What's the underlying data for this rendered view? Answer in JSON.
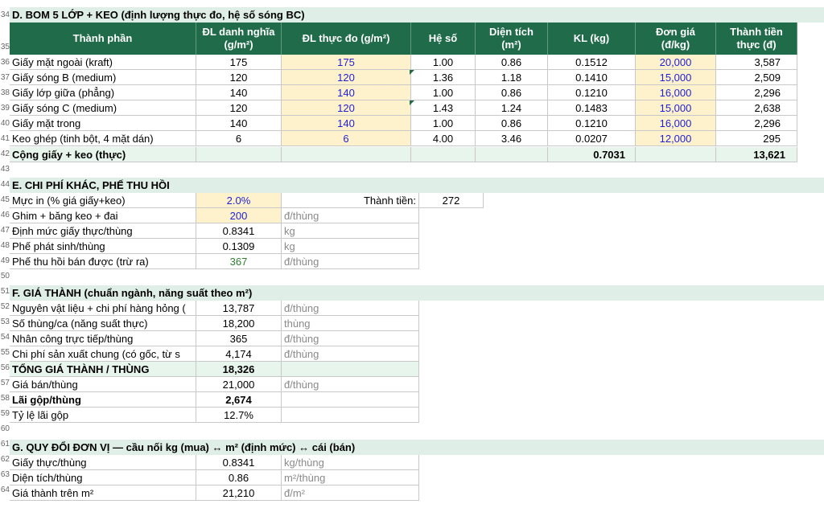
{
  "row_numbers": [
    "34",
    "35",
    "36",
    "37",
    "38",
    "39",
    "40",
    "41",
    "42",
    "43",
    "44",
    "45",
    "46",
    "47",
    "48",
    "49",
    "50",
    "51",
    "52",
    "53",
    "54",
    "55",
    "56",
    "57",
    "58",
    "59",
    "60",
    "61",
    "62",
    "63",
    "64"
  ],
  "bom": {
    "title": "D. BOM 5 LỚP + KEO (định lượng thực đo, hệ số sóng BC)",
    "headers": {
      "component": "Thành phần",
      "nominal_1": "ĐL danh nghĩa",
      "nominal_2": "(g/m²)",
      "measured": "ĐL thực đo (g/m²)",
      "factor": "Hệ số",
      "area_1": "Diện tích",
      "area_2": "(m²)",
      "weight": "KL (kg)",
      "price_1": "Đơn giá",
      "price_2": "(đ/kg)",
      "amount_1": "Thành tiền",
      "amount_2": "thực (đ)"
    },
    "rows": [
      {
        "name": "Giấy mặt ngoài (kraft)",
        "nominal": "175",
        "measured": "175",
        "factor": "1.00",
        "area": "0.86",
        "weight": "0.1512",
        "price": "20,000",
        "amount": "3,587"
      },
      {
        "name": "Giấy sóng B (medium)",
        "nominal": "120",
        "measured": "120",
        "factor": "1.36",
        "area": "1.18",
        "weight": "0.1410",
        "price": "15,000",
        "amount": "2,509"
      },
      {
        "name": "Giấy lớp giữa (phẳng)",
        "nominal": "140",
        "measured": "140",
        "factor": "1.00",
        "area": "0.86",
        "weight": "0.1210",
        "price": "16,000",
        "amount": "2,296"
      },
      {
        "name": "Giấy sóng C (medium)",
        "nominal": "120",
        "measured": "120",
        "factor": "1.43",
        "area": "1.24",
        "weight": "0.1483",
        "price": "15,000",
        "amount": "2,638"
      },
      {
        "name": "Giấy mặt trong",
        "nominal": "140",
        "measured": "140",
        "factor": "1.00",
        "area": "0.86",
        "weight": "0.1210",
        "price": "16,000",
        "amount": "2,296"
      },
      {
        "name": "Keo ghép (tinh bột, 4 mặt dán)",
        "nominal": "6",
        "measured": "6",
        "factor": "4.00",
        "area": "3.46",
        "weight": "0.0207",
        "price": "12,000",
        "amount": "295"
      }
    ],
    "total": {
      "label": "Cộng giấy + keo (thực)",
      "weight": "0.7031",
      "amount": "13,621"
    }
  },
  "other": {
    "title": "E. CHI PHÍ KHÁC, PHẾ THU HỒI",
    "ink_label": "Mực in (% giá giấy+keo)",
    "ink_value": "2.0%",
    "amount_label": "Thành tiền:",
    "amount_value": "272",
    "rows": [
      {
        "label": "Ghim + băng keo + đai",
        "value": "200",
        "unit": "đ/thùng"
      },
      {
        "label": "Định mức giấy thực/thùng",
        "value": "0.8341",
        "unit": "kg"
      },
      {
        "label": "Phế phát sinh/thùng",
        "value": "0.1309",
        "unit": "kg"
      },
      {
        "label": "Phế thu hồi bán được (trừ ra)",
        "value": "367",
        "unit": "đ/thùng"
      }
    ]
  },
  "cost": {
    "title": "F. GIÁ THÀNH (chuẩn ngành, năng suất theo m²)",
    "rows": [
      {
        "label": "Nguyên vật liệu + chi phí hàng hỏng (",
        "value": "13,787",
        "unit": "đ/thùng"
      },
      {
        "label": "Số thùng/ca (năng suất thực)",
        "value": "18,200",
        "unit": "thùng"
      },
      {
        "label": "Nhân công trực tiếp/thùng",
        "value": "365",
        "unit": "đ/thùng"
      },
      {
        "label": "Chi phí sản xuất chung (có gốc, từ s",
        "value": "4,174",
        "unit": "đ/thùng"
      },
      {
        "label": "TỔNG GIÁ THÀNH / THÙNG",
        "value": "18,326",
        "unit": ""
      },
      {
        "label": "Giá bán/thùng",
        "value": "21,000",
        "unit": "đ/thùng"
      },
      {
        "label": "Lãi gộp/thùng",
        "value": "2,674",
        "unit": ""
      },
      {
        "label": "Tỷ lệ lãi gộp",
        "value": "12.7%",
        "unit": ""
      }
    ]
  },
  "convert": {
    "title": "G. QUY ĐỔI ĐƠN VỊ — cầu nối kg (mua) ↔ m² (định mức) ↔ cái (bán)",
    "rows": [
      {
        "label": "Giấy thực/thùng",
        "value": "0.8341",
        "unit": "kg/thùng"
      },
      {
        "label": "Diện tích/thùng",
        "value": "0.86",
        "unit": "m²/thùng"
      },
      {
        "label": "Giá thành trên m²",
        "value": "21,210",
        "unit": "đ/m²"
      }
    ]
  }
}
